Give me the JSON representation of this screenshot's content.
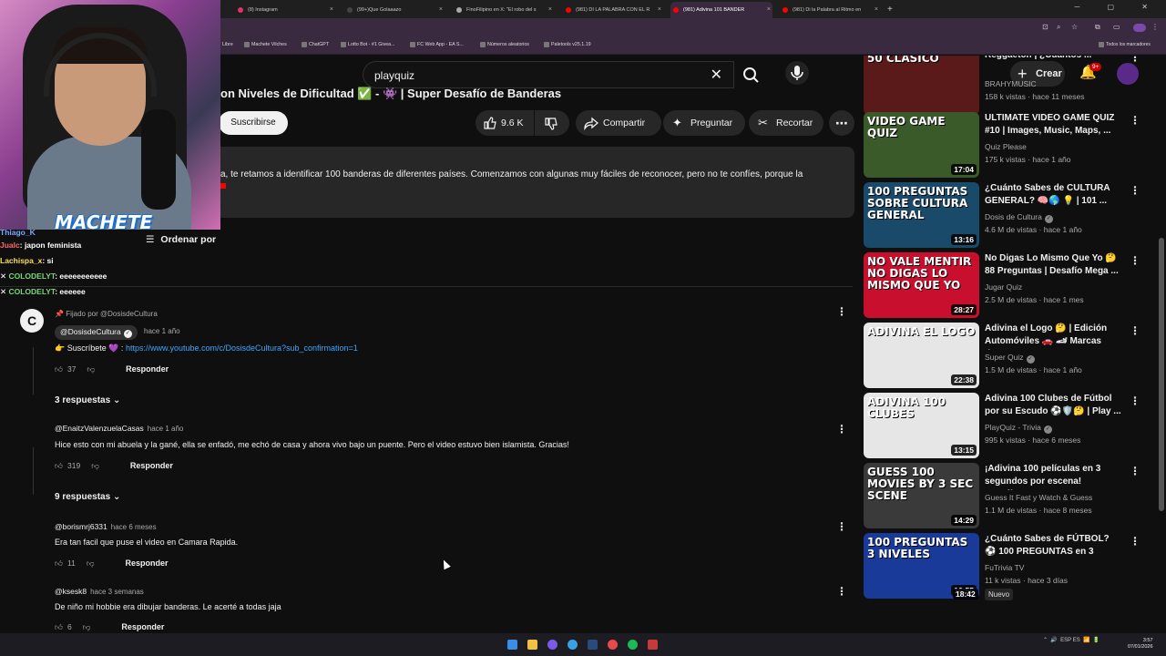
{
  "browser": {
    "tabs": [
      {
        "label": "(8) Instagram",
        "color": "#e1306c"
      },
      {
        "label": "(99+)Que Golaaazo",
        "color": "#222"
      },
      {
        "label": "FinoFilipino en X: \"El robo del s",
        "color": "#333"
      },
      {
        "label": "(981) DI LA PALABRA CON EL R",
        "color": "#ff0000"
      },
      {
        "label": "(981) Adivina 101 BANDER",
        "color": "#ff0000"
      },
      {
        "label": "(981) Di la Palabra al Ritmo en",
        "color": "#ff0000"
      }
    ],
    "bookmarks": [
      "Libre",
      "Machete Vilches",
      "ChatGPT",
      "Lotto Bot - #1 Givea...",
      "FC Web App - EA S...",
      "Números aleatorios",
      "Paletools v25.1.19"
    ],
    "bookmarks_right": "Todos los marcadores"
  },
  "youtube": {
    "search_query": "playquiz",
    "create_label": "Crear",
    "notif_count": "9+",
    "video_title": "on Niveles de Dificultad ✅ - 👾 | Super Desafío de Banderas",
    "subscribe_label": "Suscribirse",
    "likes": "9.6 K",
    "share_label": "Compartir",
    "ask_label": "Preguntar",
    "clip_label": "Recortar",
    "description": "a, te retamos a identificar 100 banderas de diferentes países. Comenzamos con algunas muy fáciles de reconocer, pero no te confíes, porque la",
    "sort_label": "Ordenar por",
    "pinned": {
      "pinned_by": "Fijado por @DosisdeCultura",
      "author": "@DosisdeCultura",
      "ago": "hace 1 año",
      "text_prefix": "👉 Suscríbete 💜 : ",
      "link": "https://www.youtube.com/c/DosisdeCultura?sub_confirmation=1",
      "likes": "37",
      "reply_label": "Responder",
      "replies": "3 respuestas"
    },
    "comments": [
      {
        "author": "@EnaitzValenzuelaCasas",
        "ago": "hace 1 año",
        "text": "Hice esto con mi abuela y la gané, ella se enfadó, me echó de casa y ahora vivo bajo un puente. Pero el video estuvo bien islamista. Gracias!",
        "likes": "319",
        "reply_label": "Responder",
        "replies": "9 respuestas"
      },
      {
        "author": "@borismrj6331",
        "ago": "hace 6 meses",
        "text": "Era tan facil  que puse el video en Camara Rapida.",
        "likes": "11",
        "reply_label": "Responder"
      },
      {
        "author": "@ksesk8",
        "ago": "hace 3 semanas",
        "text": "De niño mi hobbie era dibujar banderas. Le acerté a todas jaja",
        "likes": "6",
        "reply_label": "Responder"
      }
    ],
    "recommended": [
      {
        "thumb_text": "50 CLÁSICO",
        "thumb_color": "#5a1a1a",
        "duration": "",
        "title": "Reggaeton | ¿Cuántos ...",
        "channel": "BRAHYMUSIC",
        "verified": false,
        "views": "158 k vistas · hace 11 meses"
      },
      {
        "thumb_text": "VIDEO GAME QUIZ",
        "thumb_color": "#3a5a2a",
        "duration": "17:04",
        "title": "ULTIMATE VIDEO GAME QUIZ #10 | Images, Music, Maps, ...",
        "channel": "Quiz Please",
        "verified": false,
        "views": "175 k vistas · hace 1 año"
      },
      {
        "thumb_text": "100 PREGUNTAS SOBRE CULTURA GENERAL",
        "thumb_color": "#1a4a6a",
        "duration": "13:16",
        "title": "¿Cuánto Sabes de CULTURA GENERAL? 🧠🌎 💡 | 101 ...",
        "channel": "Dosis de Cultura",
        "verified": true,
        "views": "4.6 M de vistas · hace 1 año"
      },
      {
        "thumb_text": "NO VALE MENTIR NO DIGAS LO MISMO QUE YO",
        "thumb_color": "#c8102e",
        "duration": "28:27",
        "title": "No Digas Lo Mismo Que Yo 🤔 88 Preguntas | Desafío Mega ...",
        "channel": "Jugar Quiz",
        "verified": false,
        "views": "2.5 M de vistas · hace 1 mes"
      },
      {
        "thumb_text": "ADIVINA EL LOGO",
        "thumb_color": "#e6e6e6",
        "duration": "22:38",
        "title": "Adivina el Logo 🤔 | Edición Automóviles 🚗 🏎 Marcas de...",
        "channel": "Super Quiz",
        "verified": true,
        "views": "1.5 M de vistas · hace 1 año"
      },
      {
        "thumb_text": "ADIVINA 100 CLUBES",
        "thumb_color": "#e6e6e6",
        "duration": "13:15",
        "title": "Adivina 100 Clubes de Fútbol por su Escudo ⚽🛡️🤔 | Play ...",
        "channel": "PlayQuiz - Trivia",
        "verified": true,
        "views": "995 k vistas · hace 6 meses"
      },
      {
        "thumb_text": "GUESS 100 MOVIES BY 3 SEC SCENE",
        "thumb_color": "#3a3a3a",
        "duration": "14:29",
        "title": "¡Adivina 100 películas en 3 segundos por escena! Desafío...",
        "channel": "Guess It Fast y Watch & Guess",
        "verified": false,
        "views": "1.1 M de vistas · hace 8 meses"
      },
      {
        "thumb_text": "100 PREGUNTAS 3 NIVELES",
        "thumb_color": "#1a3a9a",
        "duration": "16:55",
        "title": "¿Cuánto Sabes de FÚTBOL? ⚽ 100 PREGUNTAS en 3 NIVELE...",
        "channel": "FuTrivia TV",
        "verified": false,
        "views": "11 k vistas · hace 3 días",
        "badge": "Nuevo"
      },
      {
        "thumb_text": "",
        "thumb_color": "#000",
        "duration": "18:42",
        "title": "",
        "channel": "",
        "verified": false,
        "views": ""
      }
    ]
  },
  "stream": {
    "brand": "MACHETE",
    "chat": [
      {
        "user": "Thiago_K",
        "msg": ""
      },
      {
        "user": "Jualc",
        "msg": ": japon feminista"
      },
      {
        "user": "Lachispa_x",
        "msg": ": si"
      },
      {
        "user": "COLODELYT",
        "msg": ": eeeeeeeeeee"
      },
      {
        "user": "COLODELYT",
        "msg": ": eeeeee"
      }
    ]
  },
  "taskbar": {
    "lang": "ESP ES",
    "time": "3:57",
    "date": "07/01/2026"
  }
}
